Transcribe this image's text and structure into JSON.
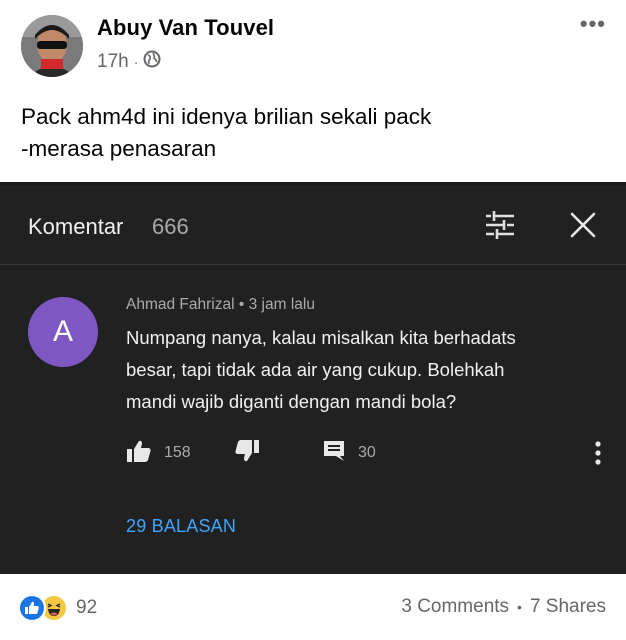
{
  "post": {
    "author": "Abuy Van Touvel",
    "time": "17h",
    "separator": "·",
    "privacy_icon": "globe-icon",
    "more_icon": "ellipsis-icon",
    "more_label": "•••",
    "text_line1": "Pack ahm4d ini idenya brilian sekali pack",
    "text_line2": "-merasa penasaran"
  },
  "embed": {
    "sheet_title": "Komentar",
    "comment_count": "666",
    "sort_icon": "sort-filter-icon",
    "close_icon": "close-icon",
    "comment": {
      "avatar_letter": "A",
      "avatar_color": "#7e57c2",
      "author": "Ahmad Fahrizal",
      "separator": "•",
      "time": "3 jam lalu",
      "body_line1": "Numpang nanya, kalau misalkan kita berhadats",
      "body_line2": "besar, tapi tidak ada air yang cukup. Bolehkah",
      "body_line3": "mandi wajib diganti dengan mandi bola?",
      "likes": "158",
      "replies_count": "30",
      "replies_link": "29 BALASAN"
    }
  },
  "footer": {
    "reaction_icons": [
      "like-reaction-icon",
      "haha-reaction-icon"
    ],
    "reaction_count": "92",
    "comments": "3 Comments",
    "separator": "•",
    "shares": "7 Shares"
  },
  "colors": {
    "accent_link": "#3ea6ff",
    "facebook_blue": "#1b74e4",
    "dark_bg": "#212121"
  }
}
